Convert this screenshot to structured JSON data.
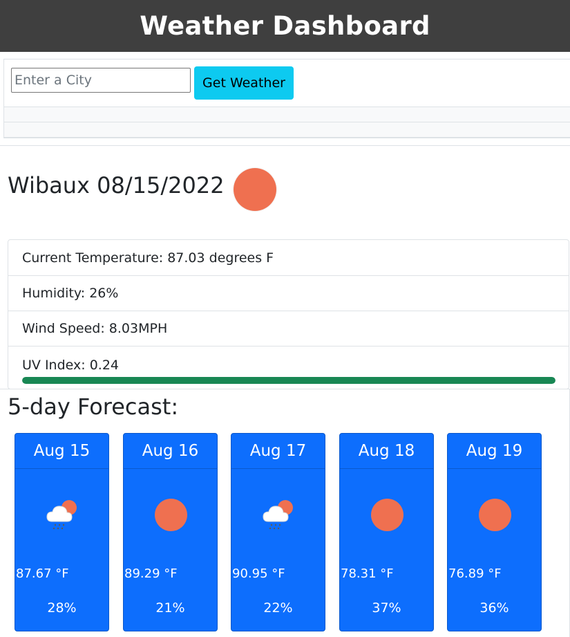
{
  "header": {
    "title": "Weather Dashboard"
  },
  "search": {
    "placeholder": "Enter a City",
    "value": "",
    "button_label": "Get Weather",
    "history": [
      "",
      ""
    ]
  },
  "current": {
    "city": "Wibaux",
    "date": "08/15/2022",
    "icon": "sun-icon",
    "temperature": "Current Temperature: 87.03 degrees F",
    "humidity": "Humidity: 26%",
    "wind": "Wind Speed: 8.03MPH",
    "uv": "UV Index: 0.24",
    "uv_bar_percent": 100,
    "uv_bar_color": "#198754"
  },
  "forecast": {
    "title": "5-day Forecast:",
    "days": [
      {
        "date": "Aug 15",
        "icon": "rain-cloud-sun-icon",
        "temp": "87.67 °F",
        "humidity": "28%"
      },
      {
        "date": "Aug 16",
        "icon": "sun-icon",
        "temp": "89.29 °F",
        "humidity": "21%"
      },
      {
        "date": "Aug 17",
        "icon": "rain-cloud-sun-icon",
        "temp": "90.95 °F",
        "humidity": "22%"
      },
      {
        "date": "Aug 18",
        "icon": "sun-icon",
        "temp": "78.31 °F",
        "humidity": "37%"
      },
      {
        "date": "Aug 19",
        "icon": "sun-icon",
        "temp": "76.89 °F",
        "humidity": "36%"
      }
    ]
  },
  "colors": {
    "header_bg": "#3f3f3f",
    "button": "#0dcaf0",
    "card": "#0d6efd",
    "sun": "#ef7050"
  }
}
